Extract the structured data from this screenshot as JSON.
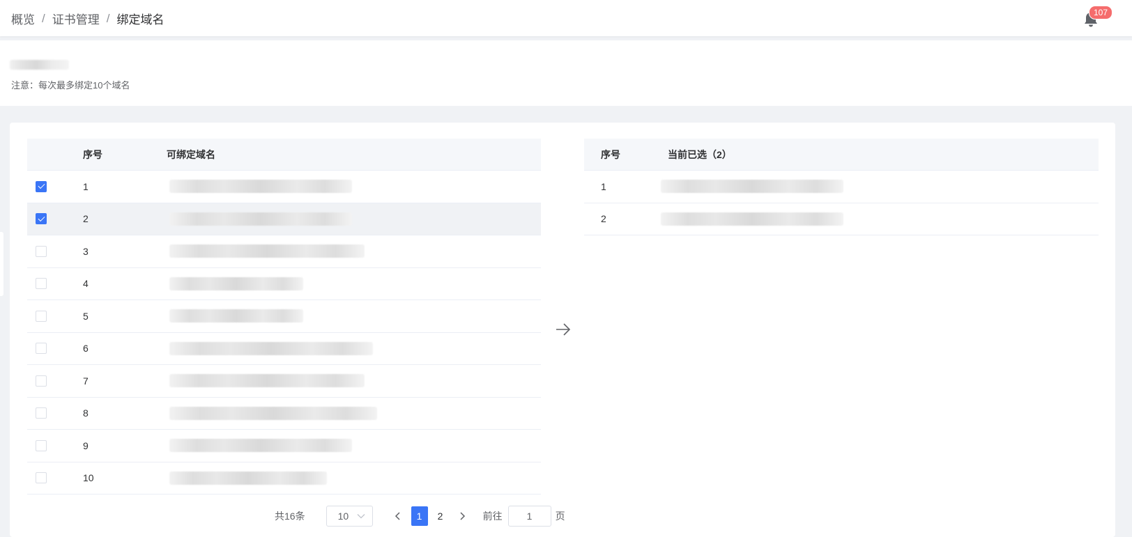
{
  "breadcrumb": {
    "items": [
      "概览",
      "证书管理",
      "绑定域名"
    ],
    "separator": "/"
  },
  "header": {
    "notification_count": "107",
    "bell_icon": "bell-icon",
    "badge_color": "#f56c6c"
  },
  "info": {
    "note": "注意：每次最多绑定10个域名"
  },
  "left_table": {
    "columns": [
      "序号",
      "可绑定域名"
    ],
    "rows": [
      {
        "index": "1",
        "checked": true
      },
      {
        "index": "2",
        "checked": true
      },
      {
        "index": "3",
        "checked": false
      },
      {
        "index": "4",
        "checked": false
      },
      {
        "index": "5",
        "checked": false
      },
      {
        "index": "6",
        "checked": false
      },
      {
        "index": "7",
        "checked": false
      },
      {
        "index": "8",
        "checked": false
      },
      {
        "index": "9",
        "checked": false
      },
      {
        "index": "10",
        "checked": false
      }
    ]
  },
  "right_table": {
    "columns": [
      "序号",
      "当前已选（2）"
    ],
    "rows": [
      {
        "index": "1"
      },
      {
        "index": "2"
      }
    ]
  },
  "transfer": {
    "icon": "arrow-right-icon"
  },
  "pagination": {
    "total_text": "共16条",
    "page_size": "10",
    "pages": [
      "1",
      "2"
    ],
    "current_page": "1",
    "goto_label": "前往",
    "goto_value": "1",
    "goto_suffix": "页"
  },
  "colors": {
    "primary": "#3a75f6",
    "header_bg": "#f5f7fa",
    "page_bg": "#f0f2f5"
  }
}
